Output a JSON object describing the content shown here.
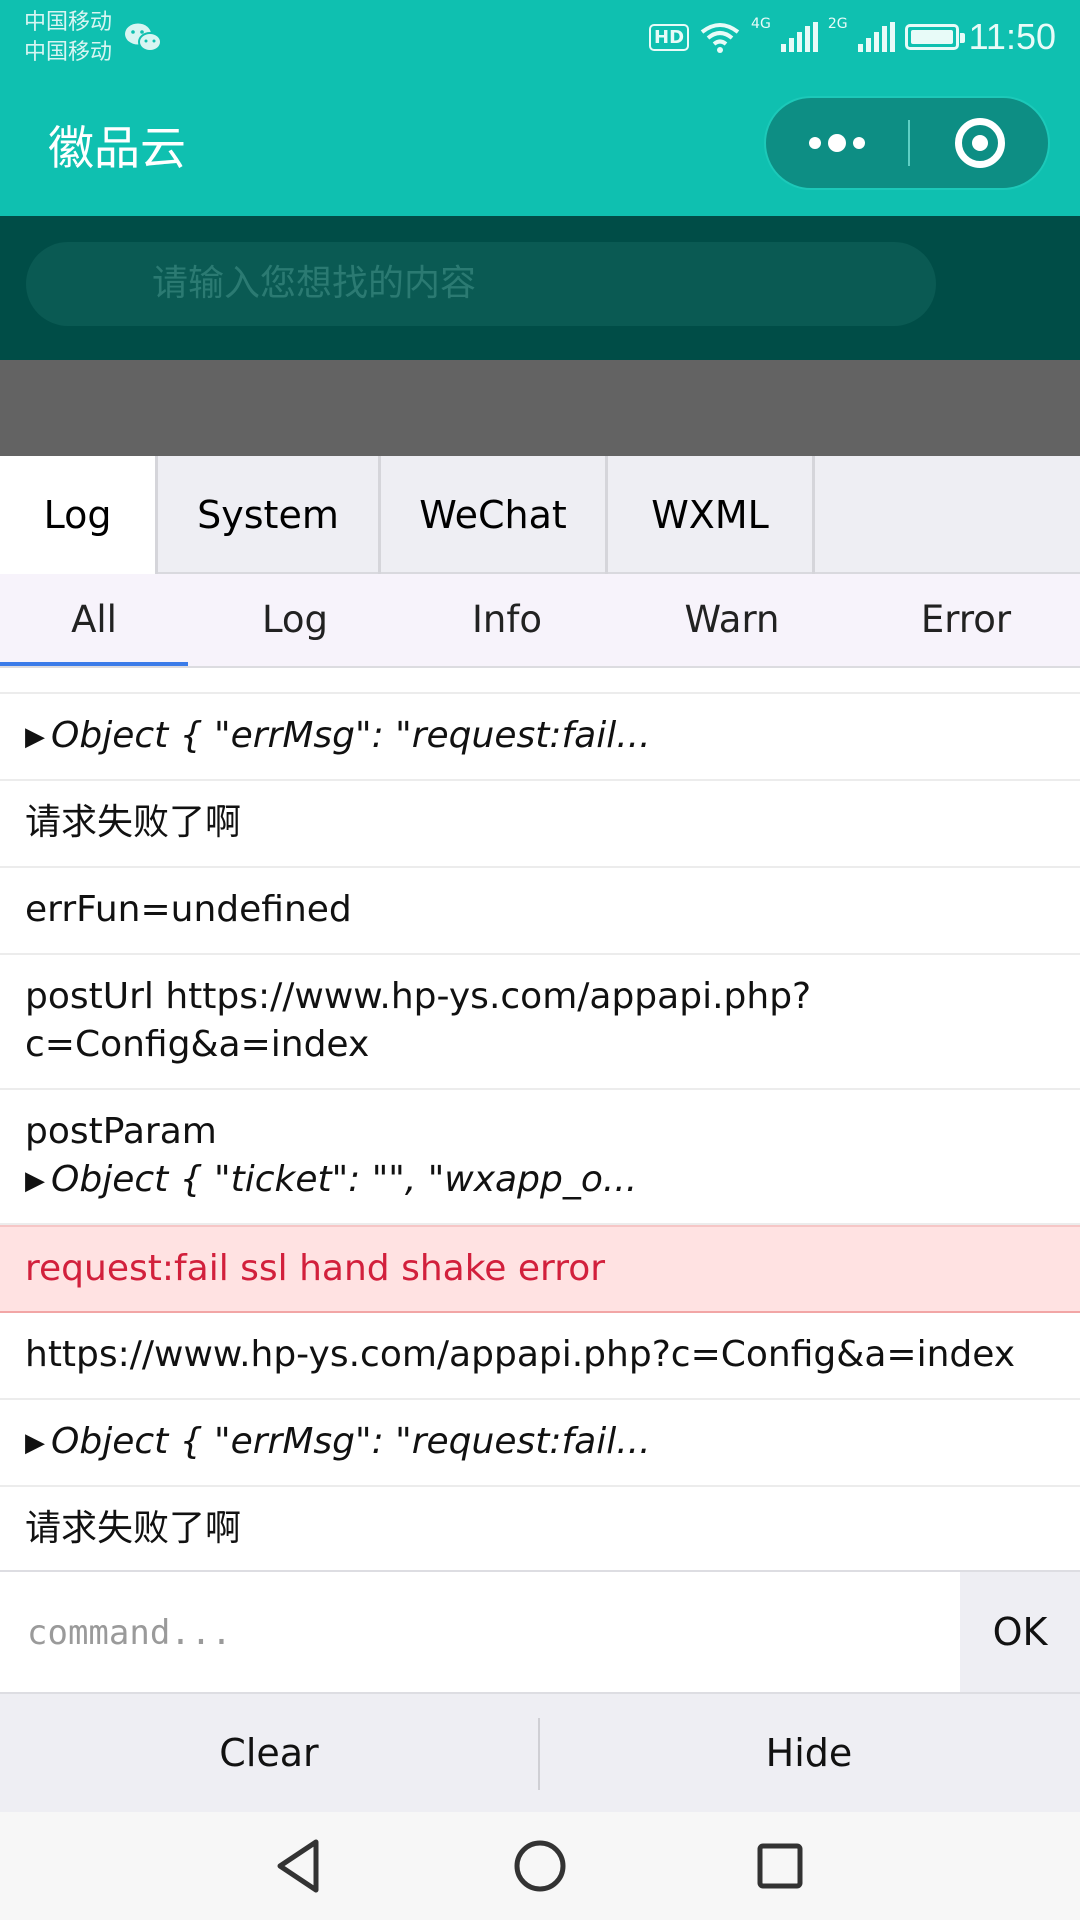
{
  "status_bar": {
    "carrier_1": "中国移动",
    "carrier_2": "中国移动",
    "hd_badge": "HD",
    "net_4g": "4G",
    "net_2g": "2G",
    "time": "11:50"
  },
  "nav": {
    "title": "徽品云",
    "more_icon": "more-dots-icon",
    "close_icon": "target-ring-icon"
  },
  "search": {
    "placeholder": "请输入您想找的内容"
  },
  "console": {
    "tabs": [
      {
        "label": "Log",
        "active": true
      },
      {
        "label": "System",
        "active": false
      },
      {
        "label": "WeChat",
        "active": false
      },
      {
        "label": "WXML",
        "active": false
      }
    ],
    "subtabs": [
      {
        "label": "All",
        "active": true
      },
      {
        "label": "Log",
        "active": false
      },
      {
        "label": "Info",
        "active": false
      },
      {
        "label": "Warn",
        "active": false
      },
      {
        "label": "Error",
        "active": false
      }
    ],
    "logs": [
      {
        "type": "object",
        "text": "Object { \"errMsg\": \"request:fail..."
      },
      {
        "type": "text",
        "text": "请求失败了啊"
      },
      {
        "type": "text",
        "text": "errFun=undefined"
      },
      {
        "type": "text",
        "text": "postUrl https://www.hp-ys.com/appapi.php?",
        "text2": "c=Config&a=index"
      },
      {
        "type": "text+object",
        "text": "postParam",
        "text2": "Object { \"ticket\": \"\", \"wxapp_o..."
      },
      {
        "type": "error",
        "text": "request:fail ssl hand shake error"
      },
      {
        "type": "text",
        "text": "https://www.hp-ys.com/appapi.php?c=Config&a=index"
      },
      {
        "type": "object",
        "text": "Object { \"errMsg\": \"request:fail..."
      },
      {
        "type": "text",
        "text": "请求失败了啊"
      }
    ],
    "command_placeholder": "command...",
    "ok_label": "OK",
    "clear_label": "Clear",
    "hide_label": "Hide"
  },
  "colors": {
    "header": "#0fc0b0",
    "search_bg": "#004d47",
    "error_text": "#d2203c",
    "error_bg": "#ffe2e2",
    "active_tab_indicator": "#3b7ce9"
  }
}
